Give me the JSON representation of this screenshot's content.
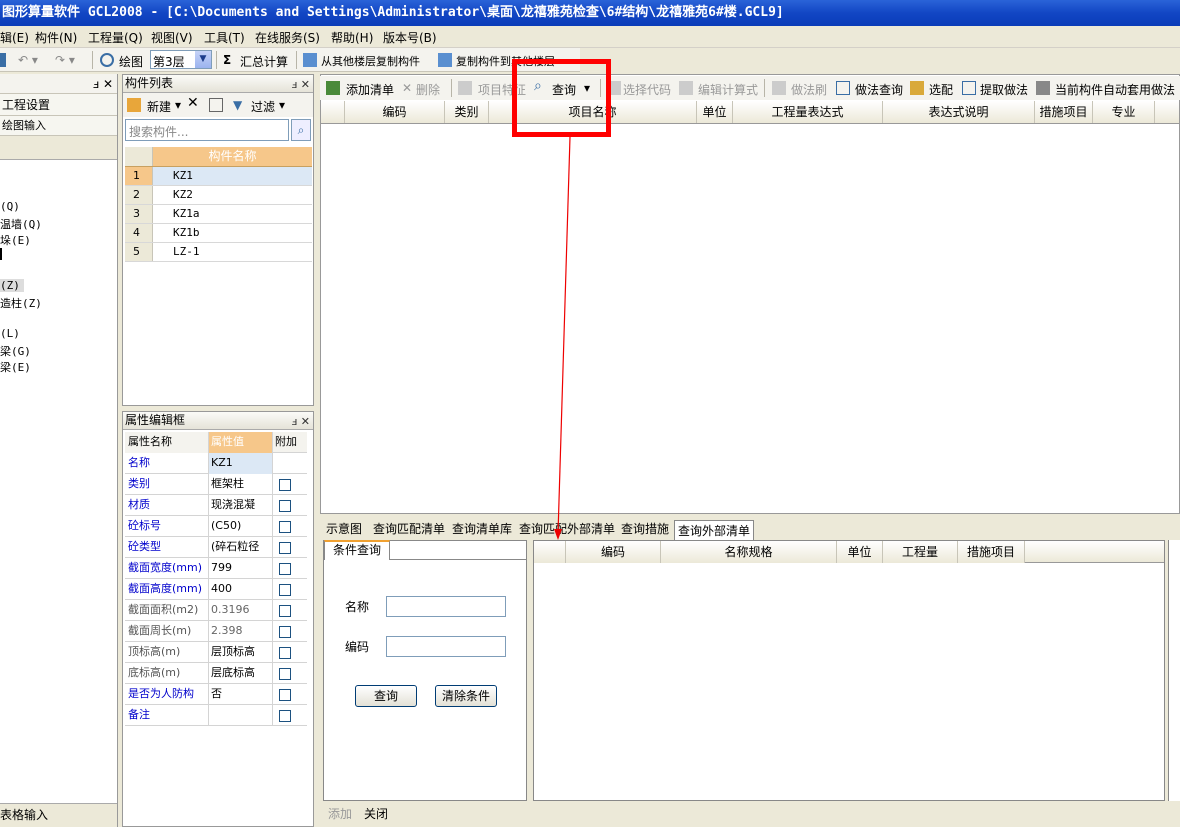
{
  "window": {
    "title": "图形算量软件 GCL2008 - [C:\\Documents and Settings\\Administrator\\桌面\\龙禧雅苑检查\\6#结构\\龙禧雅苑6#楼.GCL9]"
  },
  "menubar": {
    "items": [
      "辑(E)",
      "构件(N)",
      "工程量(Q)",
      "视图(V)",
      "工具(T)",
      "在线服务(S)",
      "帮助(H)",
      "版本号(B)"
    ]
  },
  "toolbar1": {
    "draw": "绘图",
    "floor": "第3层",
    "sum": "汇总计算",
    "copy_from": "从其他楼层复制构件",
    "copy_to": "复制构件到其他楼层"
  },
  "leftpane": {
    "project_settings": "工程设置",
    "drawing_input": "绘图输入",
    "tree": [
      "(Q)",
      "温墙(Q)",
      "垛(E)",
      "",
      "(Z)",
      "造柱(Z)",
      "(L)",
      "梁(G)",
      "梁(E)"
    ],
    "table_input": "表格输入"
  },
  "component_list": {
    "title": "构件列表",
    "new_label": "新建",
    "filter_label": "过滤",
    "search_placeholder": "搜索构件...",
    "column": "构件名称",
    "rows": [
      {
        "n": "1",
        "name": "KZ1"
      },
      {
        "n": "2",
        "name": "KZ2"
      },
      {
        "n": "3",
        "name": "KZ1a"
      },
      {
        "n": "4",
        "name": "KZ1b"
      },
      {
        "n": "5",
        "name": "LZ-1"
      }
    ]
  },
  "property_editor": {
    "title": "属性编辑框",
    "headers": [
      "属性名称",
      "属性值",
      "附加"
    ],
    "rows": [
      {
        "name": "名称",
        "value": "KZ1",
        "blue": true
      },
      {
        "name": "类别",
        "value": "框架柱",
        "blue": true
      },
      {
        "name": "材质",
        "value": "现浇混凝",
        "blue": true
      },
      {
        "name": "砼标号",
        "value": "(C50)",
        "blue": true
      },
      {
        "name": "砼类型",
        "value": "(碎石粒径",
        "blue": true
      },
      {
        "name": "截面宽度(mm)",
        "value": "799",
        "blue": true
      },
      {
        "name": "截面高度(mm)",
        "value": "400",
        "blue": true
      },
      {
        "name": "截面面积(m2)",
        "value": "0.3196",
        "blue": false
      },
      {
        "name": "截面周长(m)",
        "value": "2.398",
        "blue": false
      },
      {
        "name": "顶标高(m)",
        "value": "层顶标高",
        "blue": false
      },
      {
        "name": "底标高(m)",
        "value": "层底标高",
        "blue": false
      },
      {
        "name": "是否为人防构",
        "value": "否",
        "blue": true
      },
      {
        "name": "备注",
        "value": "",
        "blue": true
      }
    ]
  },
  "toolbar2": {
    "items": [
      "添加清单",
      "删除",
      "项目特征",
      "查询",
      "选择代码",
      "编辑计算式",
      "做法刷",
      "做法查询",
      "选配",
      "提取做法",
      "当前构件自动套用做法"
    ]
  },
  "main_grid": {
    "headers": [
      "编码",
      "类别",
      "项目名称",
      "单位",
      "工程量表达式",
      "表达式说明",
      "措施项目",
      "专业"
    ]
  },
  "bottom_tabs": [
    "示意图",
    "查询匹配清单",
    "查询清单库",
    "查询匹配外部清单",
    "查询措施",
    "查询外部清单"
  ],
  "condition": {
    "tab": "条件查询",
    "name_label": "名称",
    "code_label": "编码",
    "query_button": "查询",
    "clear_button": "清除条件"
  },
  "result_grid": {
    "headers": [
      "编码",
      "名称规格",
      "单位",
      "工程量",
      "措施项目"
    ]
  },
  "bottom_bar": {
    "add": "添加",
    "close": "关闭"
  },
  "colors": {
    "highlight": "#ff0000",
    "title_blue": "#1246c4",
    "header_orange": "#f6c78a"
  }
}
